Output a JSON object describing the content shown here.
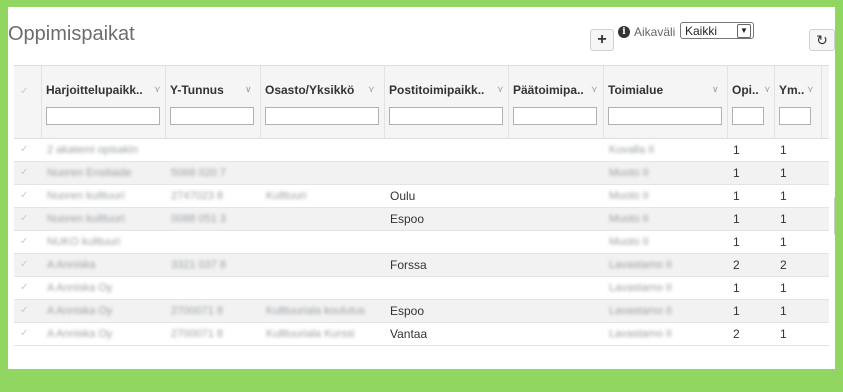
{
  "header": {
    "title": "Oppimispaikat",
    "add_label": "+",
    "info_label": "i",
    "aikavali_label": "Aikaväli",
    "aikavali_value": "Kaikki",
    "refresh_label": "↻"
  },
  "columns": [
    {
      "label": "Harjoittelupaikk..",
      "sort": "⋎"
    },
    {
      "label": "Y-Tunnus",
      "sort": "∨"
    },
    {
      "label": "Osasto/Yksikkö",
      "sort": "⋎"
    },
    {
      "label": "Postitoimipaikk..",
      "sort": "⋎"
    },
    {
      "label": "Päätoimipa..",
      "sort": "⋎"
    },
    {
      "label": "Toimialue",
      "sort": "∨"
    },
    {
      "label": "Opi..",
      "sort": "⋎"
    },
    {
      "label": "Ym..",
      "sort": "⋎"
    }
  ],
  "rows": [
    {
      "c1": "2 akatemi opisakin",
      "c2": "",
      "c3": "",
      "c4": "",
      "c5": "",
      "c6": "Kuvalla II",
      "c7": "1",
      "c8": "1"
    },
    {
      "c1": "Nuoren Ensitaide",
      "c2": "5068 020 7",
      "c3": "",
      "c4": "",
      "c5": "",
      "c6": "Muoto II",
      "c7": "1",
      "c8": "1"
    },
    {
      "c1": "Nuoren kulttuuri",
      "c2": "2747023 8",
      "c3": "Kulttuuri",
      "c4": "Oulu",
      "c5": "",
      "c6": "Muoto II",
      "c7": "1",
      "c8": "1"
    },
    {
      "c1": "Nuoren kulttuuri",
      "c2": "0088 051 3",
      "c3": "",
      "c4": "Espoo",
      "c5": "",
      "c6": "Muoto II",
      "c7": "1",
      "c8": "1"
    },
    {
      "c1": "NUKO kulttuuri",
      "c2": "",
      "c3": "",
      "c4": "",
      "c5": "",
      "c6": "Muoto II",
      "c7": "1",
      "c8": "1"
    },
    {
      "c1": "A Anniska",
      "c2": "3321 037 8",
      "c3": "",
      "c4": "Forssa",
      "c5": "",
      "c6": "Lavastamo II",
      "c7": "2",
      "c8": "2"
    },
    {
      "c1": "A Anniska Oy",
      "c2": "",
      "c3": "",
      "c4": "",
      "c5": "",
      "c6": "Lavastamo II",
      "c7": "1",
      "c8": "1"
    },
    {
      "c1": "A Anniska Oy",
      "c2": "2700071 8",
      "c3": "Kulttuuriala koulutus",
      "c4": "Espoo",
      "c5": "",
      "c6": "Lavastamo II",
      "c7": "1",
      "c8": "1"
    },
    {
      "c1": "A Anniska Oy",
      "c2": "2700071 8",
      "c3": "Kulttuuriala Kurssi",
      "c4": "Vantaa",
      "c5": "",
      "c6": "Lavastamo II",
      "c7": "2",
      "c8": "1"
    }
  ]
}
